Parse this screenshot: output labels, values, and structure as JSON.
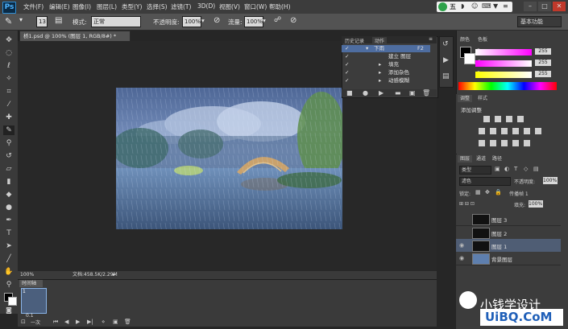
{
  "menubar": {
    "logo": "Ps",
    "items": [
      "文件(F)",
      "编辑(E)",
      "图像(I)",
      "图层(L)",
      "类型(Y)",
      "选择(S)",
      "滤镜(T)",
      "3D(D)",
      "视图(V)",
      "窗口(W)",
      "帮助(H)"
    ],
    "ime": "五"
  },
  "options": {
    "brush_size": "13",
    "mode_label": "模式:",
    "mode_value": "正常",
    "opacity_label": "不透明度:",
    "opacity_value": "100%",
    "flow_label": "流量:",
    "flow_value": "100%",
    "workspace": "基本功能"
  },
  "document": {
    "tab_title": "桥1.psd @ 100% (图层 1, RGB/8#) *",
    "zoom": "100%",
    "doc_size": "文档:458.5K/2.29M"
  },
  "timeline": {
    "tab": "时间轴",
    "frame_number": "1",
    "frame_time": "0.1",
    "loop": "一次"
  },
  "actions": {
    "tabs": [
      "历史记录",
      "动作"
    ],
    "rows": [
      {
        "label": "下雨",
        "shortcut": "F2",
        "selected": true
      },
      {
        "label": "建立 图层",
        "selected": false
      },
      {
        "label": "填充",
        "selected": false
      },
      {
        "label": "添加杂色",
        "selected": false
      },
      {
        "label": "动感模糊",
        "selected": false
      }
    ]
  },
  "color_panel": {
    "tabs": [
      "颜色",
      "色板"
    ],
    "channels": [
      {
        "label": "R",
        "value": "255",
        "color": "#ff4d4d"
      },
      {
        "label": "G",
        "value": "255",
        "color": "#4dff4d"
      },
      {
        "label": "B",
        "value": "255",
        "color": "#4d7dff"
      }
    ]
  },
  "adjustments": {
    "tabs": [
      "调整",
      "样式"
    ],
    "title": "添加调整"
  },
  "layers_panel": {
    "tabs": [
      "图层",
      "通道",
      "路径"
    ],
    "kind": "类型",
    "blend_mode": "滤色",
    "opacity_label": "不透明度:",
    "opacity_value": "100%",
    "lock_label": "锁定:",
    "fill_label": "填充:",
    "fill_value": "100%",
    "propagate_label": "传播帧 1",
    "layers": [
      {
        "name": "图层 3",
        "visible": false,
        "selected": false
      },
      {
        "name": "图层 2",
        "visible": false,
        "selected": false
      },
      {
        "name": "图层 1",
        "visible": true,
        "selected": true
      },
      {
        "name": "背景图层",
        "visible": true,
        "selected": false
      }
    ]
  },
  "watermark": {
    "text": "小钱学设计",
    "site": "UiBQ.CoM"
  }
}
